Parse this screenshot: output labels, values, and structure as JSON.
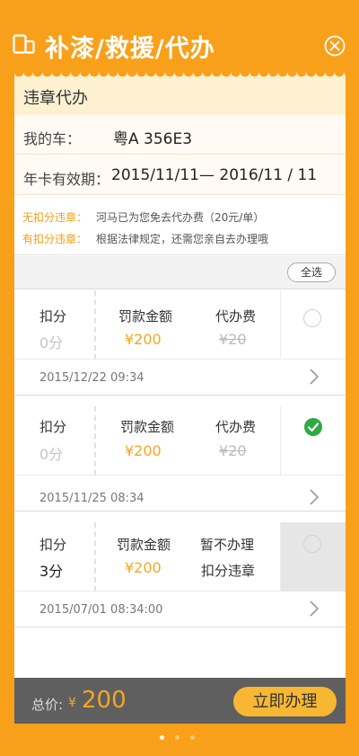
{
  "header": {
    "title": "补漆/救援/代办"
  },
  "section": {
    "title": "违章代办"
  },
  "car": {
    "label": "我的车：",
    "plate": "粤A  356E3"
  },
  "card_validity": {
    "label": "年卡有效期：",
    "value": "2015/11/11— 2016/11 / 11"
  },
  "notes": [
    {
      "label": "无扣分违章：",
      "text": "河马已为您免去代办费（20元/单）"
    },
    {
      "label": "有扣分违章：",
      "text": "根据法律规定，还需您亲自去办理哦"
    }
  ],
  "select_all_label": "全选",
  "violations": [
    {
      "points_label": "扣分",
      "points": "0分",
      "fine_label": "罚款金额",
      "fine": "¥200",
      "fee_label": "代办费",
      "fee": "¥20",
      "datetime": "2015/12/22  09:34",
      "selected": false
    },
    {
      "points_label": "扣分",
      "points": "0分",
      "fine_label": "罚款金额",
      "fine": "¥200",
      "fee_label": "代办费",
      "fee": "¥20",
      "datetime": "2015/11/25  08:34",
      "selected": true
    },
    {
      "points_label": "扣分",
      "points": "3分",
      "fine_label": "罚款金额",
      "fine": "¥200",
      "fee_label": "暂不办理",
      "fee": "扣分违章",
      "datetime": "2015/07/01  08:34:00",
      "selected": false,
      "disabled": true
    }
  ],
  "footer": {
    "total_label": "总价:",
    "currency": "¥",
    "total": "200",
    "action_label": "立即办理"
  },
  "colors": {
    "brand_orange": "#f9a01b",
    "accent": "#f5a623",
    "check_green": "#2eaa43"
  },
  "pager": {
    "pages": 3,
    "current": 1
  }
}
